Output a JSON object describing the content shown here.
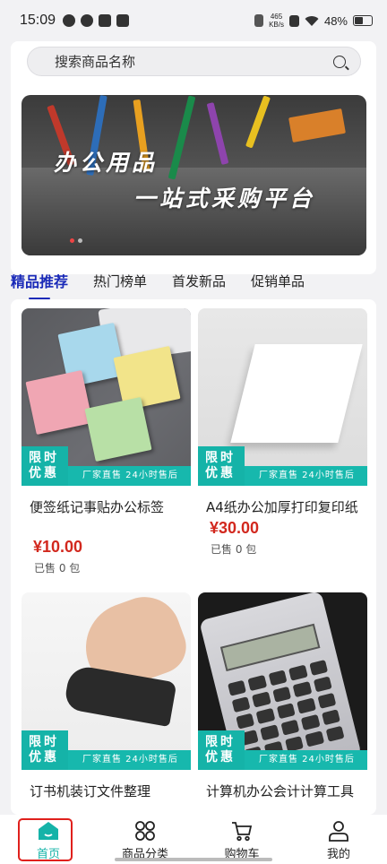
{
  "status_bar": {
    "time": "15:09",
    "speed_value": "465",
    "speed_unit": "KB/s",
    "battery": "48%"
  },
  "search": {
    "placeholder": "搜索商品名称"
  },
  "banner": {
    "line1": "办公用品",
    "line2": "一站式采购平台"
  },
  "tabs": [
    {
      "label": "精品推荐",
      "active": true
    },
    {
      "label": "热门榜单",
      "active": false
    },
    {
      "label": "首发新品",
      "active": false
    },
    {
      "label": "促销单品",
      "active": false
    }
  ],
  "promo": {
    "tag": "限时优惠",
    "tag_line1": "限时",
    "tag_line2": "优惠",
    "bar": "厂家直售 24小时售后"
  },
  "products": [
    {
      "title": "便签纸记事贴办公标签",
      "price": "¥10.00",
      "sold": "已售 0 包"
    },
    {
      "title": "A4纸办公加厚打印复印纸",
      "price": "¥30.00",
      "sold": "已售 0 包"
    },
    {
      "title": "订书机装订文件整理",
      "price": "",
      "sold": ""
    },
    {
      "title": "计算机办公会计计算工具",
      "price": "",
      "sold": ""
    }
  ],
  "bottom_nav": [
    {
      "label": "首页",
      "icon": "home-icon",
      "active": true
    },
    {
      "label": "商品分类",
      "icon": "category-grid-icon",
      "active": false
    },
    {
      "label": "购物车",
      "icon": "cart-icon",
      "active": false
    },
    {
      "label": "我的",
      "icon": "user-icon",
      "active": false
    }
  ],
  "colors": {
    "accent_tab": "#1a2ab8",
    "promo": "#15b3a8",
    "price": "#d2281e",
    "highlight": "#e0201c"
  }
}
